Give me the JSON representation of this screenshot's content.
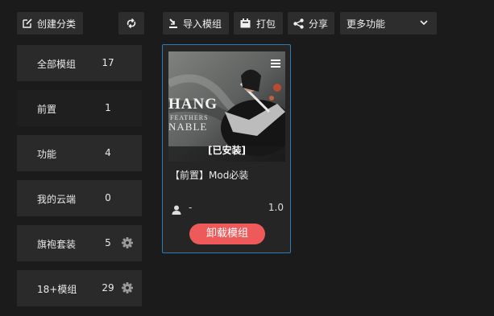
{
  "toolbar": {
    "create_category": "创建分类",
    "import_mod": "导入模组",
    "pack": "打包",
    "share": "分享",
    "more_functions": "更多功能"
  },
  "sidebar": {
    "items": [
      {
        "label": "全部模组",
        "count": "17"
      },
      {
        "label": "前置",
        "count": "1"
      },
      {
        "label": "功能",
        "count": "4"
      },
      {
        "label": "我的云端",
        "count": "0"
      },
      {
        "label": "旗袍套装",
        "count": "5"
      },
      {
        "label": "18+模组",
        "count": "29"
      }
    ]
  },
  "mod_card": {
    "status": "[已安装]",
    "title": "【前置】Mod必装",
    "author": "-",
    "version": "1.0",
    "uninstall_label": "卸载模组",
    "thumbnail_text_1": "HANG",
    "thumbnail_text_2": "FEATHERS",
    "thumbnail_text_3": "NABLE"
  },
  "colors": {
    "background": "#1b1b1b",
    "button": "#2d2d2d",
    "card_border": "#2f7bb5",
    "uninstall": "#ee5a5a"
  }
}
